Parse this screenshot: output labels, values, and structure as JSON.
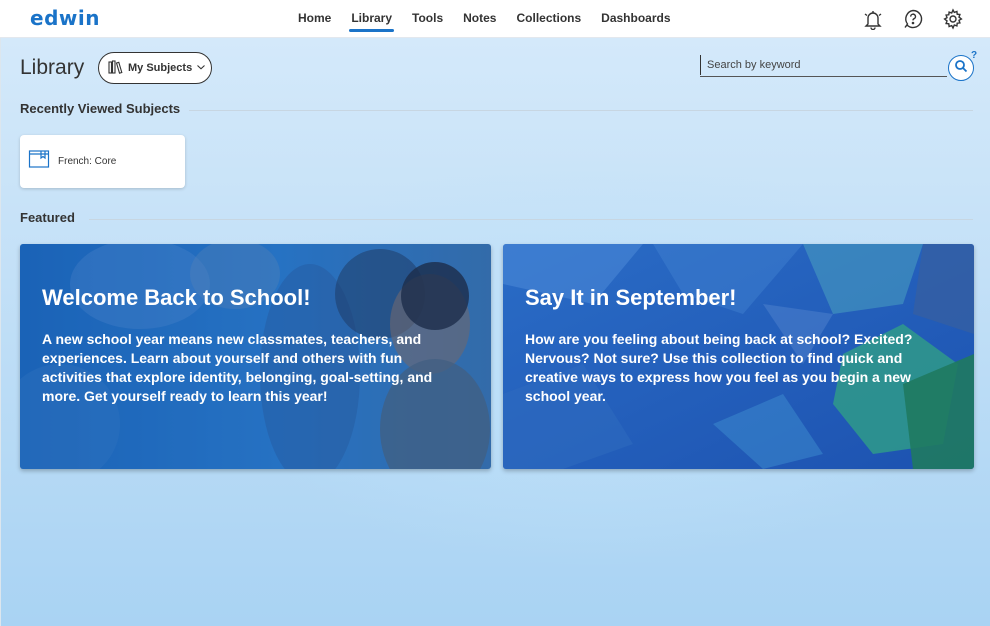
{
  "header": {
    "logo": "edwin",
    "nav": [
      {
        "label": "Home",
        "active": false
      },
      {
        "label": "Library",
        "active": true
      },
      {
        "label": "Tools",
        "active": false
      },
      {
        "label": "Notes",
        "active": false
      },
      {
        "label": "Collections",
        "active": false
      },
      {
        "label": "Dashboards",
        "active": false
      }
    ],
    "icons": [
      "notifications-bell-icon",
      "help-icon",
      "settings-gear-icon"
    ]
  },
  "page": {
    "title": "Library",
    "subjects_button": "My Subjects",
    "search_placeholder": "Search by keyword",
    "search_help": "?"
  },
  "recent": {
    "heading": "Recently Viewed Subjects",
    "items": [
      {
        "label": "French: Core",
        "icon": "book-icon"
      }
    ]
  },
  "featured": {
    "heading": "Featured",
    "cards": [
      {
        "title": "Welcome Back to School!",
        "description": "A new school year means new classmates, teachers, and experiences. Learn about yourself and others with fun activities that explore identity, belonging, goal-setting, and more. Get yourself ready to learn this year!"
      },
      {
        "title": "Say It in September!",
        "description": "How are you feeling about being back at school? Excited? Nervous? Not sure? Use this collection to find quick and creative ways to express how you feel as you begin a new school year."
      }
    ]
  },
  "colors": {
    "accent": "#1a73c8",
    "background_top": "#d4e9fa",
    "background_bottom": "#a9d3f3"
  }
}
